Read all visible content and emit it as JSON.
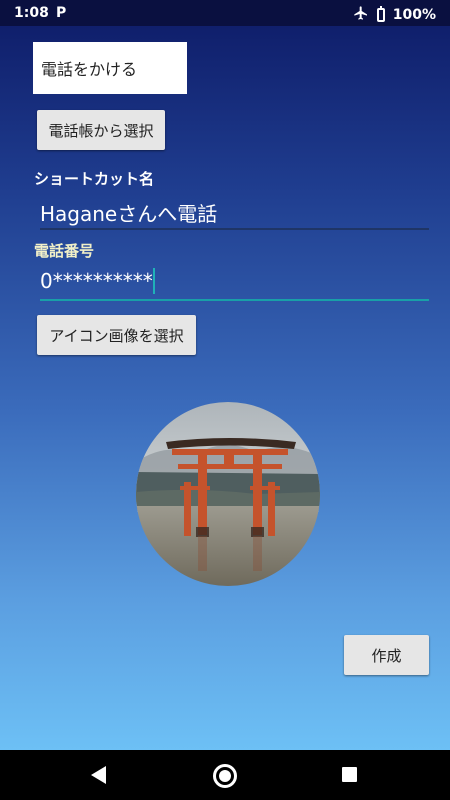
{
  "status_bar": {
    "time": "1:08",
    "notification_icon": "P",
    "battery": "100%",
    "icons": [
      "airplane-icon",
      "battery-icon"
    ]
  },
  "form": {
    "action_spinner_value": "電話をかける",
    "contacts_button_label": "電話帳から選択",
    "shortcut_name_label": "ショートカット名",
    "shortcut_name_value": "Haganeさんへ電話",
    "phone_label": "電話番号",
    "phone_value": "0**********",
    "icon_button_label": "アイコン画像を選択",
    "create_button_label": "作成"
  },
  "preview_image": {
    "subject": "torii gate in water",
    "shape": "circle"
  },
  "nav_bar": {
    "icons": [
      "back-icon",
      "home-icon",
      "recents-icon"
    ]
  },
  "colors": {
    "phone_label": "#f2f0c8",
    "phone_underline": "#19a0a8",
    "shortcut_underline": "#1f3566",
    "button_bg": "#e6e6e6"
  }
}
